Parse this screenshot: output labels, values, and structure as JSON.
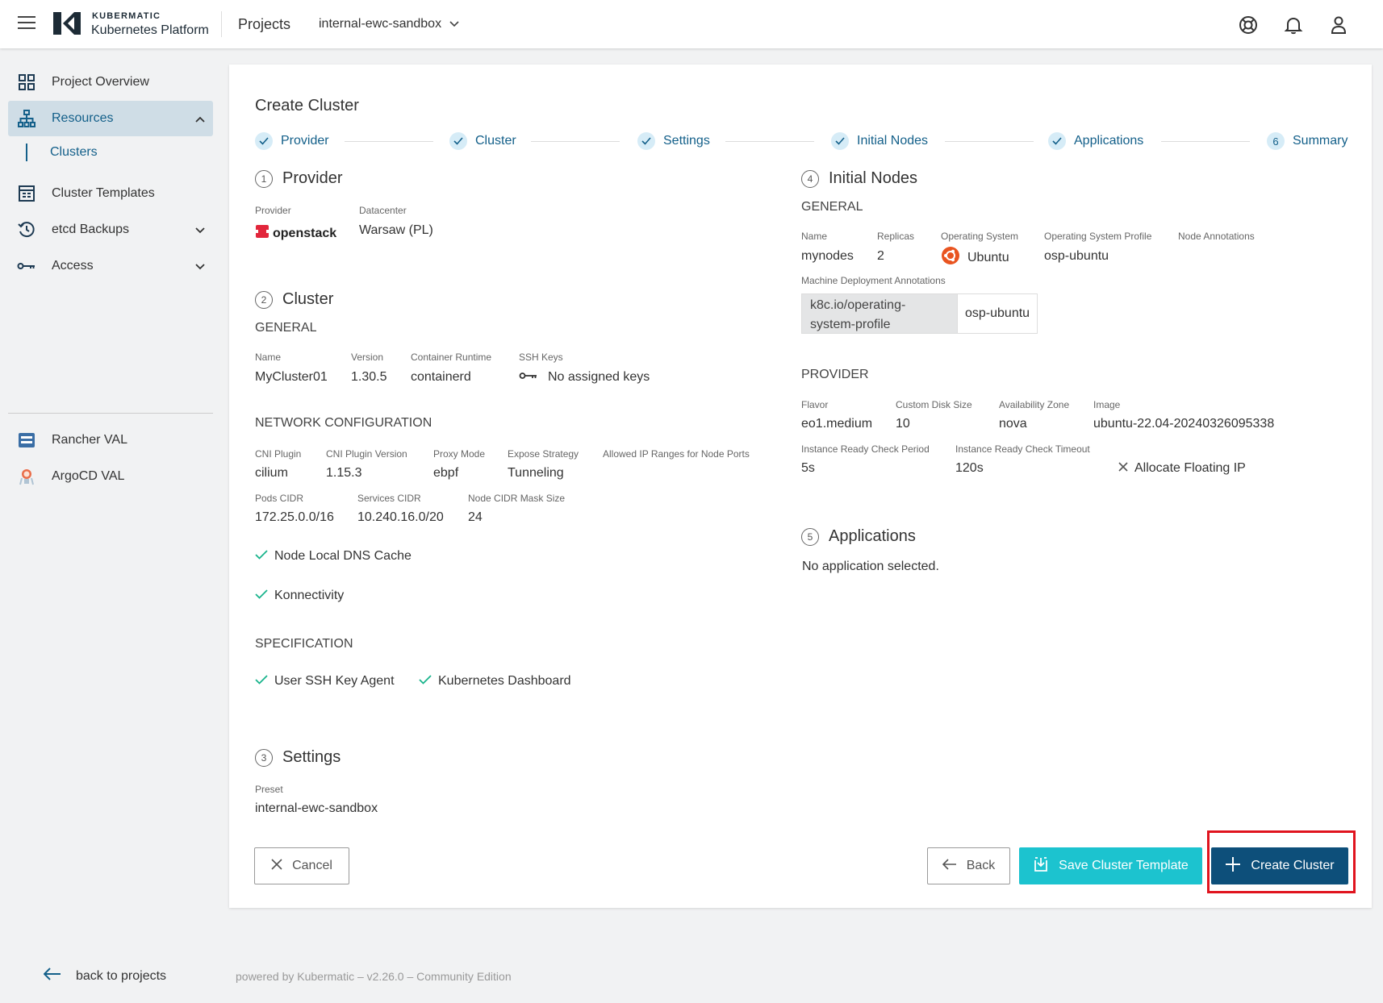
{
  "topbar": {
    "brand_top": "KUBERMATIC",
    "brand_bottom": "Kubernetes Platform",
    "projects_label": "Projects",
    "project_select_value": "internal-ewc-sandbox"
  },
  "sidebar": {
    "items": [
      {
        "label": "Project Overview",
        "icon": "grid-icon"
      },
      {
        "label": "Resources",
        "icon": "sitemap-icon"
      },
      {
        "label": "Clusters"
      },
      {
        "label": "Cluster Templates",
        "icon": "template-icon"
      },
      {
        "label": "etcd Backups",
        "icon": "history-icon"
      },
      {
        "label": "Access",
        "icon": "key-icon"
      },
      {
        "label": "Rancher VAL",
        "icon": "rancher-icon"
      },
      {
        "label": "ArgoCD VAL",
        "icon": "argocd-icon"
      }
    ],
    "back_label": "back to projects"
  },
  "footer": {
    "powered": "powered by Kubermatic – v2.26.0 – Community Edition"
  },
  "card": {
    "title": "Create Cluster",
    "steps": [
      {
        "label": "Provider",
        "state": "done"
      },
      {
        "label": "Cluster",
        "state": "done"
      },
      {
        "label": "Settings",
        "state": "done"
      },
      {
        "label": "Initial Nodes",
        "state": "done"
      },
      {
        "label": "Applications",
        "state": "done"
      },
      {
        "label": "Summary",
        "number": "6",
        "state": "current"
      }
    ],
    "provider": {
      "num": "1",
      "title": "Provider",
      "provider_label": "Provider",
      "provider_value": "openstack",
      "datacenter_label": "Datacenter",
      "datacenter_value": "Warsaw (PL)"
    },
    "cluster": {
      "num": "2",
      "title": "Cluster",
      "general": "GENERAL",
      "name_label": "Name",
      "name_value": "MyCluster01",
      "version_label": "Version",
      "version_value": "1.30.5",
      "runtime_label": "Container Runtime",
      "runtime_value": "containerd",
      "ssh_label": "SSH Keys",
      "ssh_value": "No assigned keys",
      "network": "NETWORK CONFIGURATION",
      "cni_label": "CNI Plugin",
      "cni_value": "cilium",
      "cniv_label": "CNI Plugin Version",
      "cniv_value": "1.15.3",
      "proxy_label": "Proxy Mode",
      "proxy_value": "ebpf",
      "expose_label": "Expose Strategy",
      "expose_value": "Tunneling",
      "allowed_label": "Allowed IP Ranges for Node Ports",
      "pods_label": "Pods CIDR",
      "pods_value": "172.25.0.0/16",
      "services_label": "Services CIDR",
      "services_value": "10.240.16.0/20",
      "mask_label": "Node CIDR Mask Size",
      "mask_value": "24",
      "dns_cache": "Node Local DNS Cache",
      "konnectivity": "Konnectivity",
      "specification": "SPECIFICATION",
      "ssh_agent": "User SSH Key Agent",
      "k8s_dashboard": "Kubernetes Dashboard"
    },
    "settings": {
      "num": "3",
      "title": "Settings",
      "preset_label": "Preset",
      "preset_value": "internal-ewc-sandbox"
    },
    "nodes": {
      "num": "4",
      "title": "Initial Nodes",
      "general": "GENERAL",
      "name_label": "Name",
      "name_value": "mynodes",
      "replicas_label": "Replicas",
      "replicas_value": "2",
      "os_label": "Operating System",
      "os_value": "Ubuntu",
      "osp_label": "Operating System Profile",
      "osp_value": "osp-ubuntu",
      "annot_label": "Node Annotations",
      "mda_label": "Machine Deployment Annotations",
      "mda_key": "k8c.io/operating-system-profile",
      "mda_value": "osp-ubuntu",
      "provider": "PROVIDER",
      "flavor_label": "Flavor",
      "flavor_value": "eo1.medium",
      "disk_label": "Custom Disk Size",
      "disk_value": "10",
      "az_label": "Availability Zone",
      "az_value": "nova",
      "image_label": "Image",
      "image_value": "ubuntu-22.04-20240326095338",
      "ready_period_label": "Instance Ready Check Period",
      "ready_period_value": "5s",
      "ready_timeout_label": "Instance Ready Check Timeout",
      "ready_timeout_value": "120s",
      "floating_ip": "Allocate Floating IP"
    },
    "applications": {
      "num": "5",
      "title": "Applications",
      "empty": "No application selected."
    },
    "buttons": {
      "cancel": "Cancel",
      "back": "Back",
      "save_template": "Save Cluster Template",
      "create": "Create Cluster"
    }
  },
  "colors": {
    "accent": "#14608a",
    "teal": "#1cc3cf",
    "primary": "#0d4f7a",
    "check": "#19b48c",
    "highlight": "#e0141e"
  }
}
